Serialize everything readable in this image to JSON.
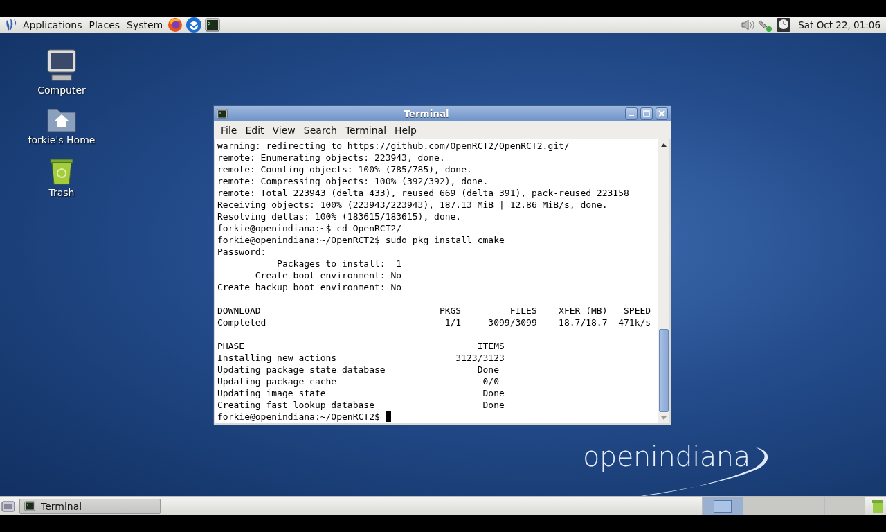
{
  "top_panel": {
    "menus": [
      "Applications",
      "Places",
      "System"
    ],
    "clock": "Sat Oct 22, 01:06"
  },
  "desktop_icons": [
    {
      "kind": "computer",
      "label": "Computer"
    },
    {
      "kind": "home",
      "label": "forkie's Home"
    },
    {
      "kind": "trash",
      "label": "Trash"
    }
  ],
  "window": {
    "title": "Terminal",
    "menu": [
      "File",
      "Edit",
      "View",
      "Search",
      "Terminal",
      "Help"
    ],
    "blocks": [
      [
        "warning: redirecting to https://github.com/OpenRCT2/OpenRCT2.git/",
        "remote: Enumerating objects: 223943, done.",
        "remote: Counting objects: 100% (785/785), done.",
        "remote: Compressing objects: 100% (392/392), done.",
        "remote: Total 223943 (delta 433), reused 669 (delta 391), pack-reused 223158",
        "Receiving objects: 100% (223943/223943), 187.13 MiB | 12.86 MiB/s, done.",
        "Resolving deltas: 100% (183615/183615), done.",
        "forkie@openindiana:~$ cd OpenRCT2/",
        "forkie@openindiana:~/OpenRCT2$ sudo pkg install cmake",
        "Password:",
        "           Packages to install:  1",
        "       Create boot environment: No",
        "Create backup boot environment: No"
      ],
      [
        "DOWNLOAD                                 PKGS         FILES    XFER (MB)   SPEED",
        "Completed                                 1/1     3099/3099    18.7/18.7  471k/s"
      ],
      [
        "PHASE                                           ITEMS",
        "Installing new actions                      3123/3123",
        "Updating package state database                 Done",
        "Updating package cache                           0/0",
        "Updating image state                             Done",
        "Creating fast lookup database                    Done",
        "forkie@openindiana:~/OpenRCT2$ "
      ]
    ]
  },
  "logo": "openindiana",
  "bottom_panel": {
    "tasks": [
      {
        "label": "Terminal"
      }
    ],
    "workspaces": [
      {
        "selected": true
      },
      {
        "selected": false
      },
      {
        "selected": false
      },
      {
        "selected": false
      }
    ]
  }
}
